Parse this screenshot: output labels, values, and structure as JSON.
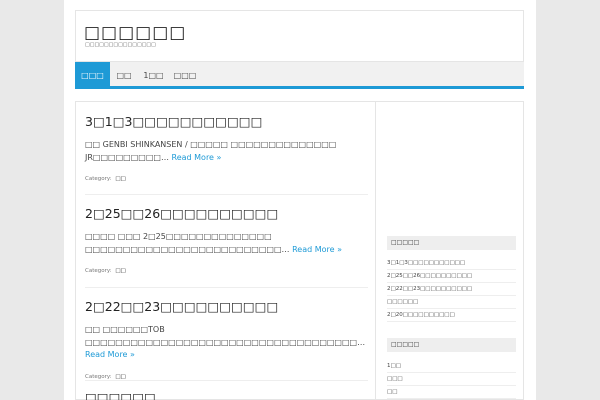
{
  "site": {
    "title": "□□□□□□",
    "description": "□□□□□□□□□□□□□□□"
  },
  "nav": {
    "items": [
      {
        "label": "□□□",
        "active": true
      },
      {
        "label": "□□",
        "active": false
      },
      {
        "label": "1□□",
        "active": false
      },
      {
        "label": "□□□",
        "active": false
      }
    ]
  },
  "posts": [
    {
      "title": "3□1□3□□□□□□□□□□□",
      "excerpt": "□□ GENBI SHINKANSEN / □□□□□ □□□□□□□□□□□□□□ JR□□□□□□□□□…",
      "read_more": "Read More »",
      "cat_label": "Category:",
      "cat": "□□"
    },
    {
      "title": "2□25□□26□□□□□□□□□□",
      "excerpt": "□□□□ □□□ 2□25□□□□□□□□□□□□□□ □□□□□□□□□□□□□□□□□□□□□□□□□□…",
      "read_more": "Read More »",
      "cat_label": "Category:",
      "cat": "□□"
    },
    {
      "title": "2□22□□23□□□□□□□□□□",
      "excerpt": "□□ □□□□□□TOB □□□□□□□□□□□□□□□□□□□□□□□□□□□□□□□□□□□□…",
      "read_more": "Read More »",
      "cat_label": "Category:",
      "cat": "□□"
    },
    {
      "title": "□□□□□□"
    }
  ],
  "sidebar": {
    "recent_title": "□□□□□",
    "recent_items": [
      "3□1□3□□□□□□□□□□□",
      "2□25□□26□□□□□□□□□□",
      "2□22□□23□□□□□□□□□□",
      "□□□□□□",
      "2□20□□□□□□□□□□"
    ],
    "cat_title": "□□□□□",
    "cat_items": [
      "1□□",
      "□□□",
      "□□"
    ]
  },
  "colors": {
    "accent": "#1e9ad6",
    "background": "#e9e9e9"
  }
}
